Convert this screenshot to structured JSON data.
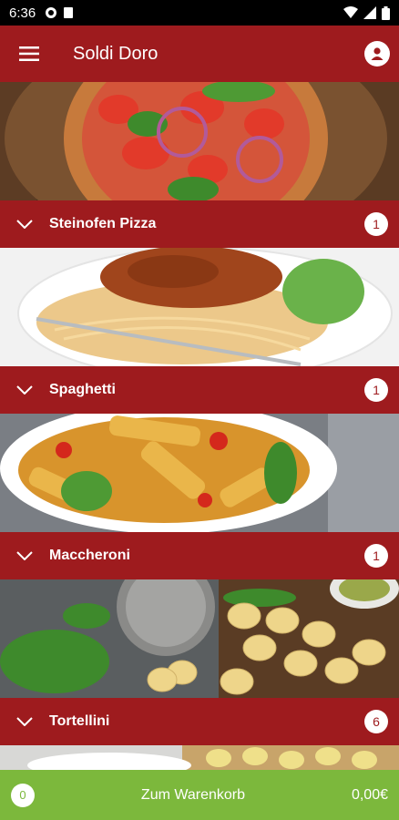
{
  "status": {
    "time": "6:36"
  },
  "app": {
    "title": "Soldi Doro"
  },
  "categories": [
    {
      "title": "Steinofen Pizza",
      "count": "1"
    },
    {
      "title": "Spaghetti",
      "count": "1"
    },
    {
      "title": "Maccheroni",
      "count": "1"
    },
    {
      "title": "Tortellini",
      "count": "6"
    }
  ],
  "cart": {
    "count": "0",
    "label": "Zum Warenkorb",
    "total": "0,00€"
  },
  "colors": {
    "primary": "#9e1b1e",
    "cart": "#7cb83c"
  },
  "icons": [
    "menu-icon",
    "account-icon",
    "chevron-down-icon",
    "wifi-icon",
    "signal-icon",
    "battery-icon"
  ]
}
